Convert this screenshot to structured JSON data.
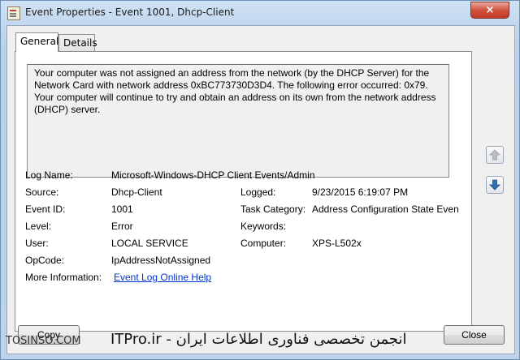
{
  "window": {
    "title": "Event Properties - Event 1001, Dhcp-Client",
    "close_glyph": "×"
  },
  "tabs": [
    {
      "label": "General",
      "active": true
    },
    {
      "label": "Details",
      "active": false
    }
  ],
  "description": "Your computer was not assigned an address from the network (by the DHCP Server) for the Network Card with network address 0xBC773730D3D4.  The following error occurred: 0x79. Your computer will continue to try and obtain an address on its own from the network address (DHCP) server.",
  "fields": {
    "log_name": {
      "label": "Log Name:",
      "value": "Microsoft-Windows-DHCP Client Events/Admin"
    },
    "source": {
      "label": "Source:",
      "value": "Dhcp-Client"
    },
    "logged": {
      "label": "Logged:",
      "value": "9/23/2015 6:19:07 PM"
    },
    "event_id": {
      "label": "Event ID:",
      "value": "1001"
    },
    "task_category": {
      "label": "Task Category:",
      "value": "Address Configuration State Event"
    },
    "level": {
      "label": "Level:",
      "value": "Error"
    },
    "keywords": {
      "label": "Keywords:",
      "value": ""
    },
    "user": {
      "label": "User:",
      "value": "LOCAL SERVICE"
    },
    "computer": {
      "label": "Computer:",
      "value": "XPS-L502x"
    },
    "opcode": {
      "label": "OpCode:",
      "value": "IpAddressNotAssigned"
    },
    "more_info": {
      "label": "More Information:",
      "value": "Event Log Online Help"
    }
  },
  "buttons": {
    "copy": "Copy",
    "close": "Close"
  },
  "nav_icons": {
    "up": "arrow-up-icon",
    "down": "arrow-down-icon"
  },
  "watermark": {
    "left": "TOSINSO.COM",
    "right": "انجمن تخصصی فناوری اطلاعات ایران - ITPro.ir"
  }
}
